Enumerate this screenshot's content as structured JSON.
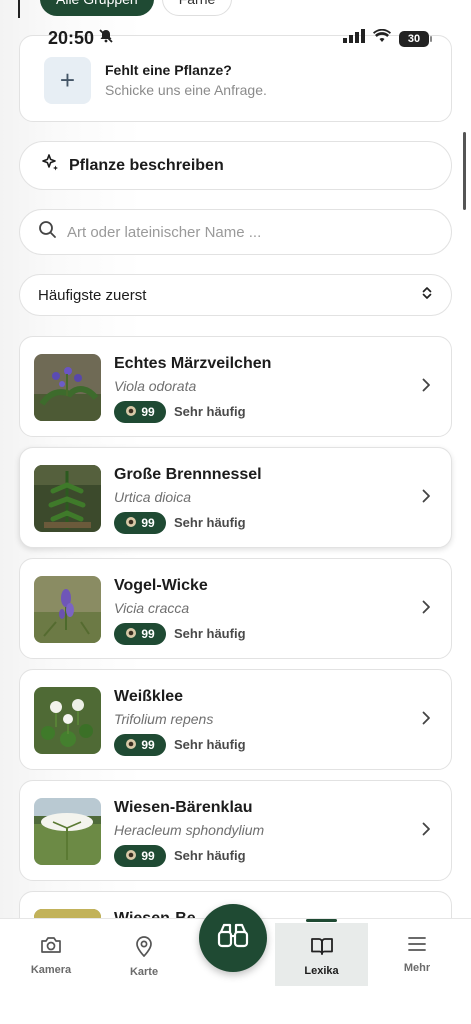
{
  "filter_chips": [
    "Alle Gruppen",
    "Farne"
  ],
  "status_bar": {
    "time": "20:50",
    "battery": "30"
  },
  "request_card": {
    "title": "Fehlt eine Pflanze?",
    "subtitle": "Schicke uns eine Anfrage.",
    "icon": "plus-icon"
  },
  "describe_button": {
    "label": "Pflanze beschreiben",
    "icon": "sparkle-icon"
  },
  "search": {
    "placeholder": "Art oder lateinischer Name ...",
    "icon": "search-icon"
  },
  "sort": {
    "label": "Häufigste zuerst",
    "icon": "sort-chevrons-icon"
  },
  "plants": [
    {
      "name": "Echtes Märzveilchen",
      "latin": "Viola odorata",
      "count": "99",
      "frequency": "Sehr häufig"
    },
    {
      "name": "Große Brennnessel",
      "latin": "Urtica dioica",
      "count": "99",
      "frequency": "Sehr häufig"
    },
    {
      "name": "Vogel-Wicke",
      "latin": "Vicia cracca",
      "count": "99",
      "frequency": "Sehr häufig"
    },
    {
      "name": "Weißklee",
      "latin": "Trifolium repens",
      "count": "99",
      "frequency": "Sehr häufig"
    },
    {
      "name": "Wiesen-Bärenklau",
      "latin": "Heracleum sphondylium",
      "count": "99",
      "frequency": "Sehr häufig"
    },
    {
      "name": "Wiesen-Be…",
      "latin": "",
      "count": "",
      "frequency": ""
    }
  ],
  "bottom_nav": {
    "camera": "Kamera",
    "map": "Karte",
    "lexika": "Lexika",
    "more": "Mehr"
  },
  "colors": {
    "accent": "#1f4a33",
    "border": "#e2e2e2",
    "active_tab_bg": "#e8ebea"
  }
}
